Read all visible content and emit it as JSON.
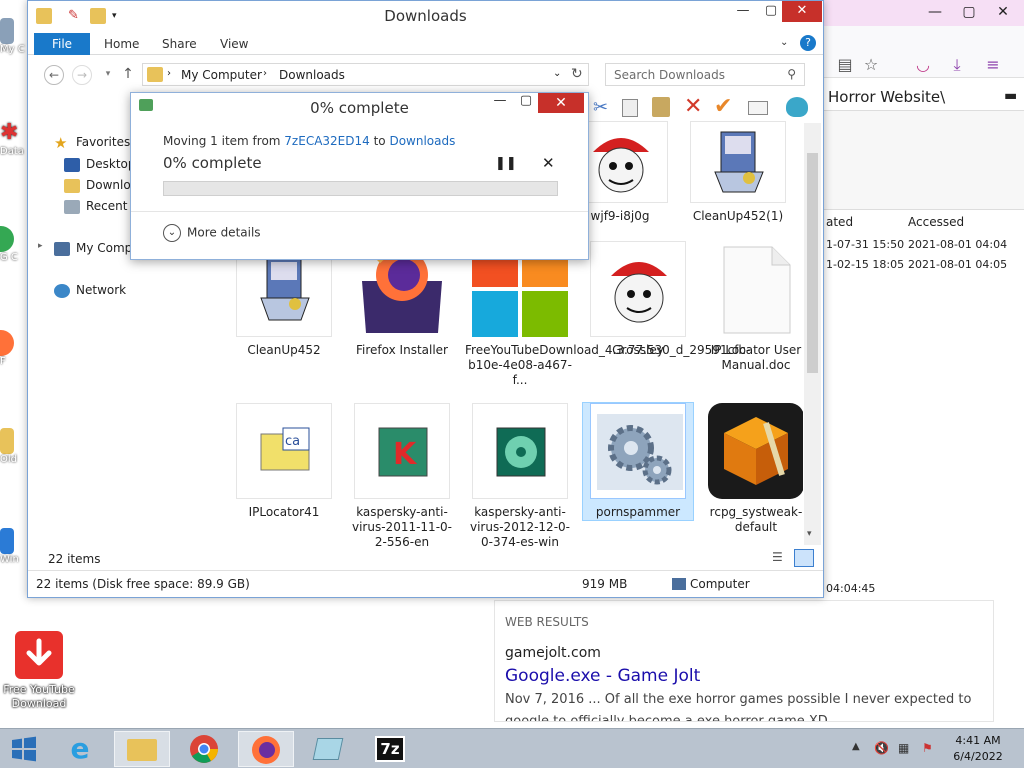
{
  "desktop": {
    "icons": [
      {
        "label": "My C"
      },
      {
        "label": "Data"
      },
      {
        "label": "G C"
      },
      {
        "label": "F"
      },
      {
        "label": "Old"
      },
      {
        "label": "Win"
      }
    ],
    "youtube_downloader": {
      "label_line1": "Free YouTube",
      "label_line2": "Download"
    }
  },
  "browser": {
    "heading": "Horror Website\\",
    "table": {
      "headers": [
        "ated",
        "Accessed"
      ],
      "rows": [
        [
          "1-07-31 15:50",
          "2021-08-01 04:04"
        ],
        [
          "1-02-15 18:05",
          "2021-08-01 04:05"
        ]
      ],
      "time_fragment": "04:04:45"
    },
    "web_results": {
      "heading": "WEB RESULTS",
      "site": "gamejolt.com",
      "link": "Google.exe - Game Jolt",
      "snippet": "Nov 7, 2016 ... Of all the exe horror games possible I never expected to",
      "snippet2": "google to officially become a exe horror game XD"
    }
  },
  "explorer": {
    "title": "Downloads",
    "ribbon_tabs": {
      "file": "File",
      "home": "Home",
      "share": "Share",
      "view": "View"
    },
    "breadcrumb": {
      "root": "My Computer",
      "arrow": "›",
      "current": "Downloads"
    },
    "search_placeholder": "Search Downloads",
    "nav": {
      "favorites": "Favorites",
      "desktop": "Desktop",
      "downloads": "Downloa",
      "recent": "Recent p",
      "my_computer": "My Comp",
      "network": "Network"
    },
    "files": [
      {
        "name": "wjf9-i8j0g",
        "kind": "santa"
      },
      {
        "name": "CleanUp452(1)",
        "kind": "installer"
      },
      {
        "name": "CleanUp452",
        "kind": "installer"
      },
      {
        "name": "Firefox Installer",
        "kind": "firefox"
      },
      {
        "name": "FreeYouTubeDownload_4.3.77.530_d_29591cfb-b10e-4e08-a467-f...",
        "kind": "windows"
      },
      {
        "name": "Grossley",
        "kind": "santa"
      },
      {
        "name": "IP Locator User Manual.doc",
        "kind": "doc"
      },
      {
        "name": "IPLocator41",
        "kind": "cab"
      },
      {
        "name": "kaspersky-anti-virus-2011-11-0-2-556-en",
        "kind": "kaspersky"
      },
      {
        "name": "kaspersky-anti-virus-2012-12-0-0-374-es-win",
        "kind": "disc"
      },
      {
        "name": "pornspammer",
        "kind": "gears"
      },
      {
        "name": "rcpg_systweak-default",
        "kind": "cube"
      }
    ],
    "items_count": "22 items",
    "status": {
      "left": "22 items (Disk free space: 89.9 GB)",
      "size": "919 MB",
      "location": "Computer"
    }
  },
  "dialog": {
    "title": "0% complete",
    "moving_prefix": "Moving 1 item from ",
    "source": "7zECA32ED14",
    "to_word": " to ",
    "destination": "Downloads",
    "percent_text": "0% complete",
    "progress": 0,
    "more_details": "More details"
  },
  "taskbar": {
    "time": "4:41 AM",
    "date": "6/4/2022",
    "apps": [
      "start",
      "ie",
      "explorer",
      "chrome",
      "firefox",
      "notepad",
      "7zip"
    ]
  },
  "colors": {
    "accent": "#1979ca",
    "close_red": "#c7302a",
    "progress_green": "#06b025",
    "link_blue": "#1a0dab"
  }
}
